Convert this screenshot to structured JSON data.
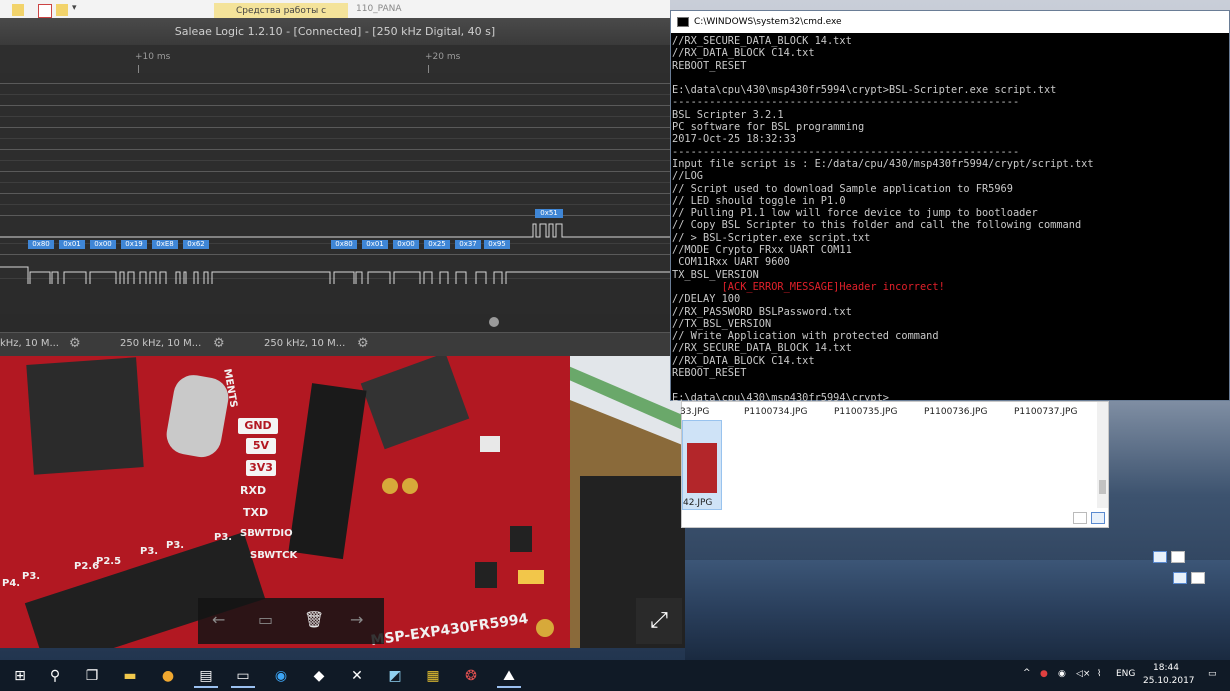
{
  "explorer_top": {
    "ribbon_tab": "Средства работы с рисунками",
    "folder_name": "110_PANA"
  },
  "saleae": {
    "title": "Saleae Logic 1.2.10 - [Connected] - [250 kHz Digital, 40 s]",
    "ruler_ticks": [
      "+10 ms",
      "+20 ms"
    ],
    "decode_labels_group1": [
      "0x80",
      "0x01",
      "0x00",
      "0x19",
      "0xE8",
      "0x62"
    ],
    "decode_labels_group2": [
      "0x80",
      "0x01",
      "0x00",
      "0x25",
      "0x37",
      "0x95"
    ],
    "decode_label_top": "0x51",
    "analyzer_tabs": [
      "kHz, 10 M...",
      "250 kHz, 10 M...",
      "250 kHz, 10 M..."
    ]
  },
  "cmd": {
    "title": "C:\\WINDOWS\\system32\\cmd.exe",
    "lines_before_error": [
      "//RX_SECURE_DATA_BLOCK 14.txt",
      "//RX_DATA_BLOCK C14.txt",
      "REBOOT_RESET",
      "",
      "E:\\data\\cpu\\430\\msp430fr5994\\crypt>BSL-Scripter.exe script.txt",
      "--------------------------------------------------------",
      "BSL Scripter 3.2.1",
      "PC software for BSL programming",
      "2017-Oct-25 18:32:33",
      "--------------------------------------------------------",
      "Input file script is : E:/data/cpu/430/msp430fr5994/crypt/script.txt",
      "//LOG",
      "// Script used to download Sample application to FR5969",
      "// LED should toggle in P1.0",
      "// Pulling P1.1 low will force device to jump to bootloader",
      "// Copy BSL Scripter to this folder and call the following command",
      "// > BSL-Scripter.exe script.txt",
      "//MODE Crypto FRxx UART COM11",
      " COM11Rxx UART 9600",
      "TX_BSL_VERSION"
    ],
    "error_line": "        [ACK_ERROR_MESSAGE]Header incorrect!",
    "lines_after_error": [
      "//DELAY 100",
      "//RX_PASSWORD BSLPassword.txt",
      "//TX_BSL_VERSION",
      "// Write Application with protected command",
      "//RX_SECURE_DATA_BLOCK 14.txt",
      "//RX_DATA_BLOCK C14.txt",
      "REBOOT_RESET",
      "",
      "E:\\data\\cpu\\430\\msp430fr5994\\crypt>"
    ]
  },
  "explorer_files": {
    "names": [
      "33.JPG",
      "P1100734.JPG",
      "P1100735.JPG",
      "P1100736.JPG",
      "P1100737.JPG"
    ],
    "selected_thumb_name": "42.JPG"
  },
  "photo": {
    "board_label": "MSP-EXP430FR5994",
    "silk_labels": [
      "GND",
      "5V",
      "3V3",
      "RXD",
      "TXD",
      "SBWTDIO",
      "SBWTCK",
      "MENTS",
      "P4.",
      "P3.",
      "P2.6",
      "P2.5",
      "P3.",
      "P3.",
      "P3."
    ]
  },
  "taskbar": {
    "lang": "ENG",
    "time": "18:44",
    "date": "25.10.2017"
  },
  "colors": {
    "decode_label": "#3f86d6",
    "cmd_error": "#e0202a",
    "ribbon_highlight": "#f4e39a"
  }
}
